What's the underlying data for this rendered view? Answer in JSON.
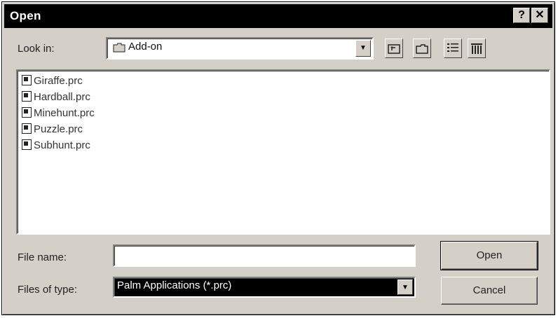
{
  "dialog": {
    "title": "Open",
    "help_button": "?",
    "close_button": "✕"
  },
  "look_in": {
    "label": "Look in:",
    "value": "Add-on"
  },
  "files": [
    {
      "name": "Giraffe.prc"
    },
    {
      "name": "Hardball.prc"
    },
    {
      "name": "Minehunt.prc"
    },
    {
      "name": "Puzzle.prc"
    },
    {
      "name": "Subhunt.prc"
    }
  ],
  "file_name": {
    "label": "File name:",
    "value": ""
  },
  "files_of_type": {
    "label": "Files of type:",
    "value": "Palm Applications (*.prc)"
  },
  "buttons": {
    "open": "Open",
    "cancel": "Cancel"
  },
  "icons": {
    "up_folder": "up-one-level-icon",
    "new_folder": "create-new-folder-icon",
    "list_view": "list-view-icon",
    "details_view": "details-view-icon"
  }
}
